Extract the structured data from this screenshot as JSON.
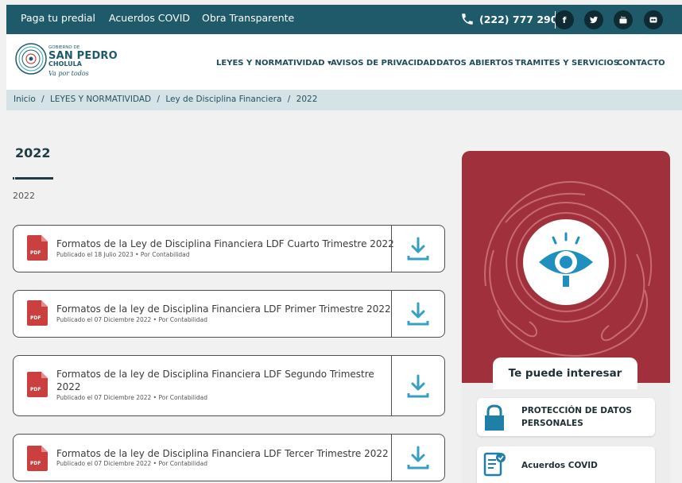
{
  "topbar": {
    "links": [
      "Paga tu predial",
      "Acuerdos COVID",
      "Obra Transparente"
    ],
    "phone": "(222) 777 2900",
    "social_icons": [
      "facebook-icon",
      "twitter-icon",
      "youtube-icon",
      "flickr-icon"
    ],
    "social_glyphs": [
      "f",
      "✦",
      "▶",
      "●"
    ]
  },
  "logo": {
    "line1": "GOBIERNO DE",
    "line2": "SAN PEDRO",
    "line3": "CHOLULA",
    "tagline": "Va por todos"
  },
  "nav": {
    "items": [
      "LEYES Y NORMATIVIDAD ▾",
      "AVISOS DE PRIVACIDAD",
      "DATOS ABIERTOS",
      "TRAMITES Y SERVICIOS",
      "CONTACTO"
    ]
  },
  "breadcrumb": [
    "Inicio",
    "/",
    "LEYES Y NORMATIVIDAD",
    "/",
    "Ley de Disciplina Financiera",
    "/",
    "2022"
  ],
  "page": {
    "title": "2022",
    "subtitle": "2022"
  },
  "documents": [
    {
      "title": "Formatos de la Ley de Disciplina Financiera LDF Cuarto Trimestre 2022",
      "meta": "Publicado el 18 Julio 2023  •  Por Contabilidad"
    },
    {
      "title": "Formatos de la ley de Disciplina Financiera LDF Primer Trimestre 2022",
      "meta": "Publicado el 07 Diciembre 2022  •  Por Contabilidad"
    },
    {
      "title": "Formatos de la ley de Disciplina Financiera LDF Segundo Trimestre 2022",
      "meta": "Publicado el 07 Diciembre 2022  •  Por Contabilidad"
    },
    {
      "title": "Formatos de la ley de Disciplina Financiera LDF Tercer Trimestre 2022",
      "meta": "Publicado el 07 Diciembre 2022  •  Por Contabilidad"
    }
  ],
  "pdf_badge": "PDF",
  "sidebar": {
    "heading": "Te puede interesar",
    "links": [
      "PROTECCIÓN DE DATOS PERSONALES",
      "Acuerdos COVID"
    ]
  },
  "colors": {
    "topbar": "#1f5a6b",
    "panel": "#a0303b",
    "accent": "#35a0c4",
    "pdf": "#c9403f"
  }
}
